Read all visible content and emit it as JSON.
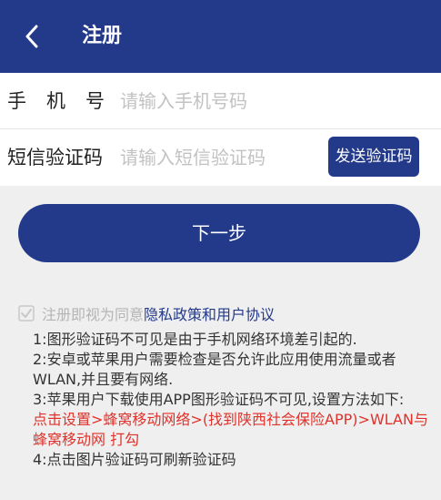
{
  "header": {
    "title": "注册"
  },
  "form": {
    "phone_label": "手机号",
    "phone_placeholder": "请输入手机号码",
    "sms_label": "短信验证码",
    "sms_placeholder": "请输入短信验证码",
    "send_code_label": "发送验证码"
  },
  "next_label": "下一步",
  "agreement": {
    "text": "注册即视为同意",
    "link": "隐私政策和用户协议"
  },
  "notes": {
    "line1": "1:图形验证码不可见是由于手机网络环境差引起的.",
    "line2": "2:安卓或苹果用户需要检查是否允许此应用使用流量或者WLAN,并且要有网络.",
    "line3": "3:苹果用户下载使用APP图形验证码不可见,设置方法如下:",
    "line3_red": "点击设置>蜂窝移动网络>(找到陕西社会保险APP)>WLAN与蜂窝移动网 打勾",
    "line4": "4:点击图片验证码可刷新验证码"
  },
  "colors": {
    "primary": "#23398a",
    "highlight": "#e0322b",
    "background": "#efefef"
  }
}
